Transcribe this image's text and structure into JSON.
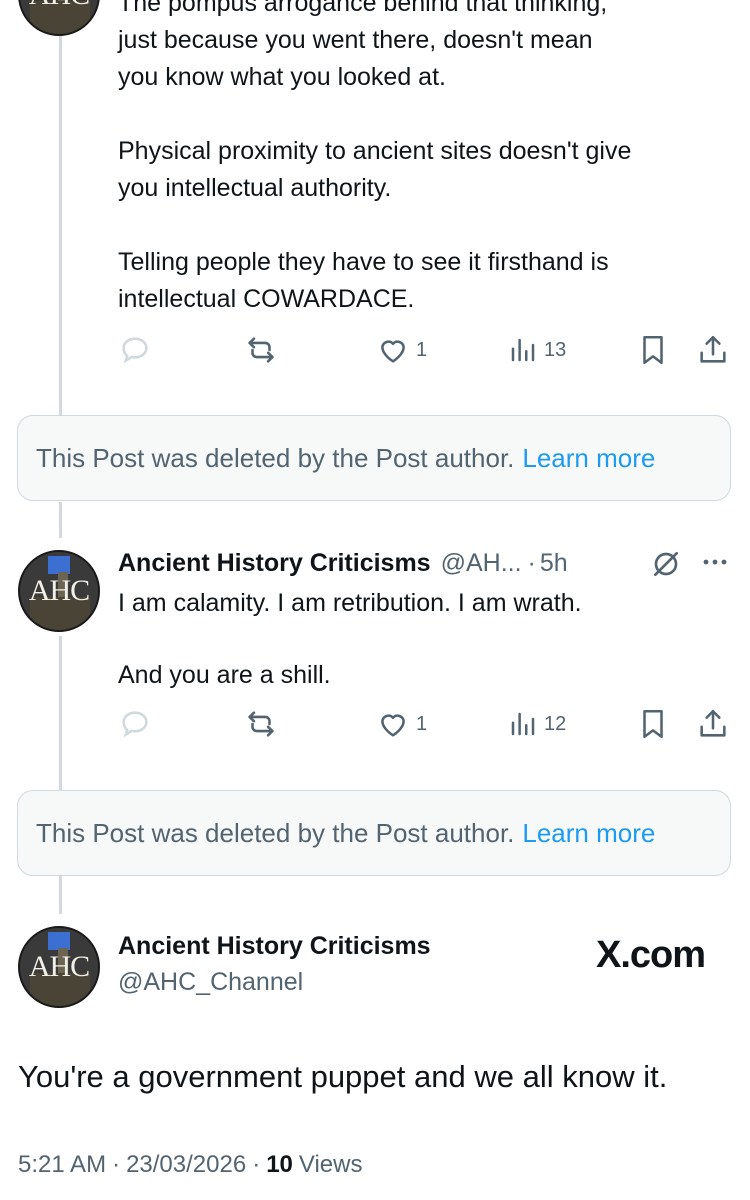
{
  "tweet1": {
    "lines": [
      "The pompus arrogance behind that thinking,",
      "just because you went there, doesn't mean",
      "you know what you looked at.",
      "Physical proximity to ancient sites doesn't give",
      "you intellectual authority.",
      "Telling people they have to see it firsthand is",
      "intellectual COWARDACE."
    ],
    "likes": "1",
    "views": "13"
  },
  "deleted_notice": {
    "text": "This Post was deleted by the Post author.",
    "link": "Learn more"
  },
  "tweet2": {
    "author_name": "Ancient History Criticisms",
    "handle_truncated": "@AH...",
    "separator": "·",
    "time": "5h",
    "lines": [
      "I am calamity. I am retribution. I am wrath.",
      "And you are a shill."
    ],
    "likes": "1",
    "views": "12"
  },
  "avatar": {
    "text": "AHC"
  },
  "main_tweet": {
    "author_name": "Ancient History Criticisms",
    "handle": "@AHC_Channel",
    "brand": "X.com",
    "text": "You're a government puppet and we all know it.",
    "time": "5:21 AM",
    "separator": "·",
    "date": "23/03/2026",
    "views_count": "10",
    "views_label": "Views"
  },
  "colors": {
    "text": "#0f1419",
    "muted": "#536471",
    "link": "#1d9bf0",
    "border": "#cfd9de",
    "notice_bg": "#f7f9f9"
  }
}
